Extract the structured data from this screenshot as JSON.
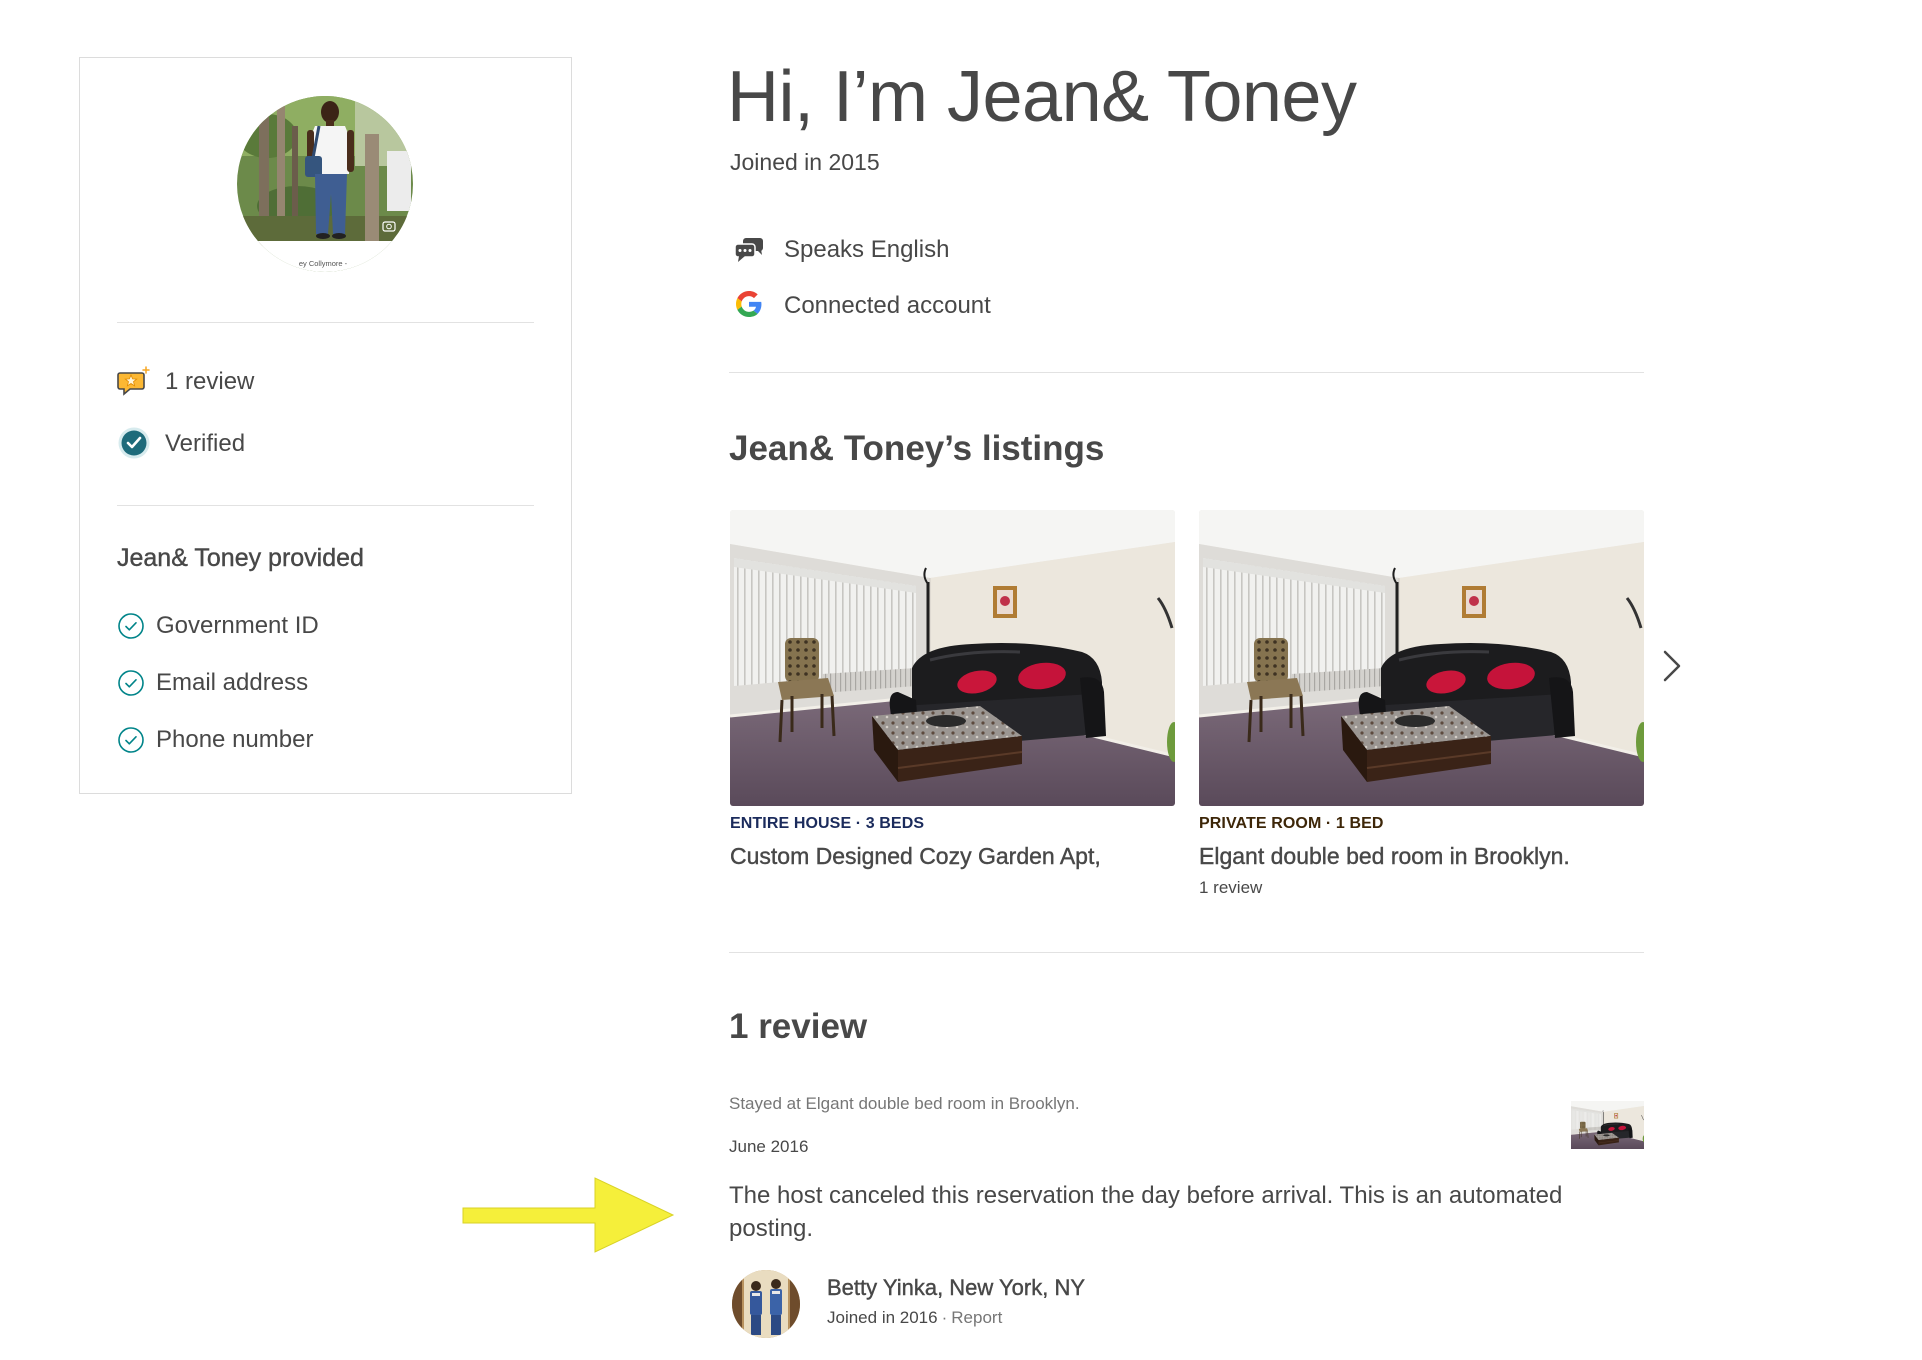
{
  "profile_card": {
    "avatar_caption": "ey Collymore -",
    "stats": [
      {
        "icon": "review-star-badge-icon",
        "label": "1 review"
      },
      {
        "icon": "verified-badge-icon",
        "label": "Verified"
      }
    ],
    "provided_title": "Jean& Toney provided",
    "provided_items": [
      {
        "icon": "check-circle-icon",
        "label": "Government ID"
      },
      {
        "icon": "check-circle-icon",
        "label": "Email address"
      },
      {
        "icon": "check-circle-icon",
        "label": "Phone number"
      }
    ]
  },
  "header": {
    "title": "Hi, I’m Jean& Toney",
    "joined": "Joined in 2015"
  },
  "about": [
    {
      "icon": "speech-bubbles-icon",
      "label": "Speaks English"
    },
    {
      "icon": "google-icon",
      "label": "Connected account"
    }
  ],
  "listings": {
    "title": "Jean& Toney’s listings",
    "next_icon": "chevron-right-icon",
    "items": [
      {
        "type": "ENTIRE HOUSE · 3 BEDS",
        "type_color": "#1b2b5c",
        "title": "Custom Designed Cozy Garden Apt,"
      },
      {
        "type": "PRIVATE ROOM · 1 BED",
        "type_color": "#3d2608",
        "title": "Elgant double bed room in Brooklyn.",
        "reviews": "1 review"
      }
    ]
  },
  "reviews": {
    "title": "1 review",
    "items": [
      {
        "stayed_at": "Stayed at Elgant double bed room in Brooklyn.",
        "date": "June 2016",
        "text": "The host canceled this reservation the day before arrival. This is an automated posting.",
        "reviewer": {
          "name": "Betty Yinka, New York, NY",
          "joined": "Joined in 2016",
          "separator": "·",
          "report_label": "Report"
        }
      }
    ]
  },
  "annotation": {
    "icon": "yellow-arrow-icon",
    "arrow_color": "#f5ef3a"
  },
  "colors": {
    "text": "#484848",
    "muted": "#767676",
    "accent": "#008489",
    "divider": "#e2e2e2"
  }
}
